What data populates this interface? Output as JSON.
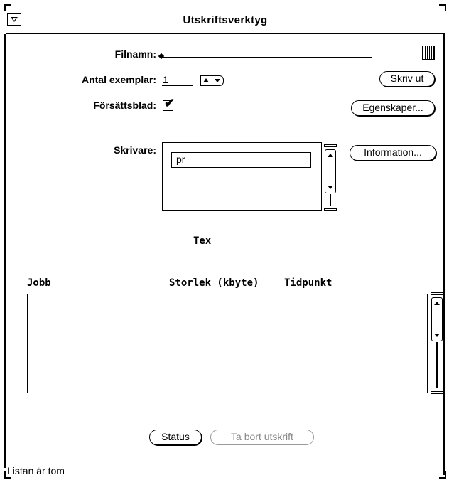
{
  "window": {
    "title": "Utskriftsverktyg"
  },
  "form": {
    "filename_label": "Filnamn:",
    "filename_value": "",
    "copies_label": "Antal exemplar:",
    "copies_value": "1",
    "cover_label": "Försättsblad:",
    "cover_checked": true,
    "printer_label": "Skrivare:",
    "printers": [
      "pr"
    ]
  },
  "buttons": {
    "print": "Skriv ut",
    "properties": "Egenskaper...",
    "information": "Information...",
    "status": "Status",
    "remove": "Ta bort utskrift"
  },
  "printer_type": "Tex",
  "queue": {
    "columns": [
      "Jobb",
      "Storlek (kbyte)",
      "Tidpunkt"
    ],
    "rows": []
  },
  "footer": {
    "message": "Listan är tom"
  },
  "icons": {
    "window_menu": "window-menu-icon",
    "file_chooser": "file-chooser-icon",
    "spin_up": "arrow-up-icon",
    "spin_down": "arrow-down-icon",
    "checkmark": "checkmark-icon"
  }
}
